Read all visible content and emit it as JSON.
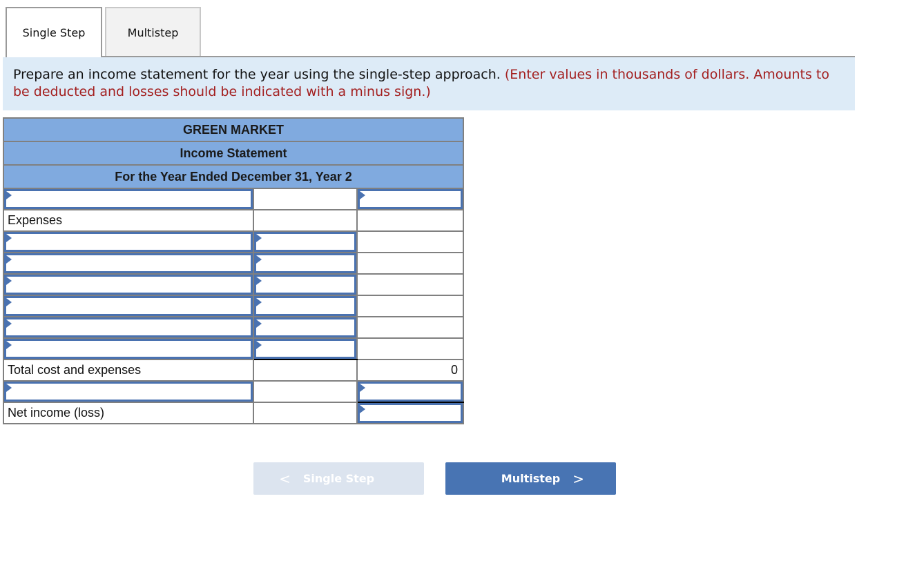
{
  "tabs": [
    {
      "label": "Single Step",
      "active": true
    },
    {
      "label": "Multistep",
      "active": false
    }
  ],
  "instructions": {
    "main": "Prepare an income statement for the year using the single-step approach. ",
    "note": "(Enter values in thousands of dollars. Amounts to be deducted and losses should be indicated with a minus sign.)"
  },
  "statement": {
    "company": "GREEN MARKET",
    "title": "Income Statement",
    "period": "For the Year Ended December 31, Year 2",
    "rows": {
      "expenses_label": "Expenses",
      "total_label": "Total cost and expenses",
      "total_value": "0",
      "net_label": "Net income (loss)"
    }
  },
  "nav": {
    "prev_label": "Single Step",
    "next_label": "Multistep",
    "prev_icon": "chevron-left-icon",
    "next_icon": "chevron-right-icon"
  }
}
